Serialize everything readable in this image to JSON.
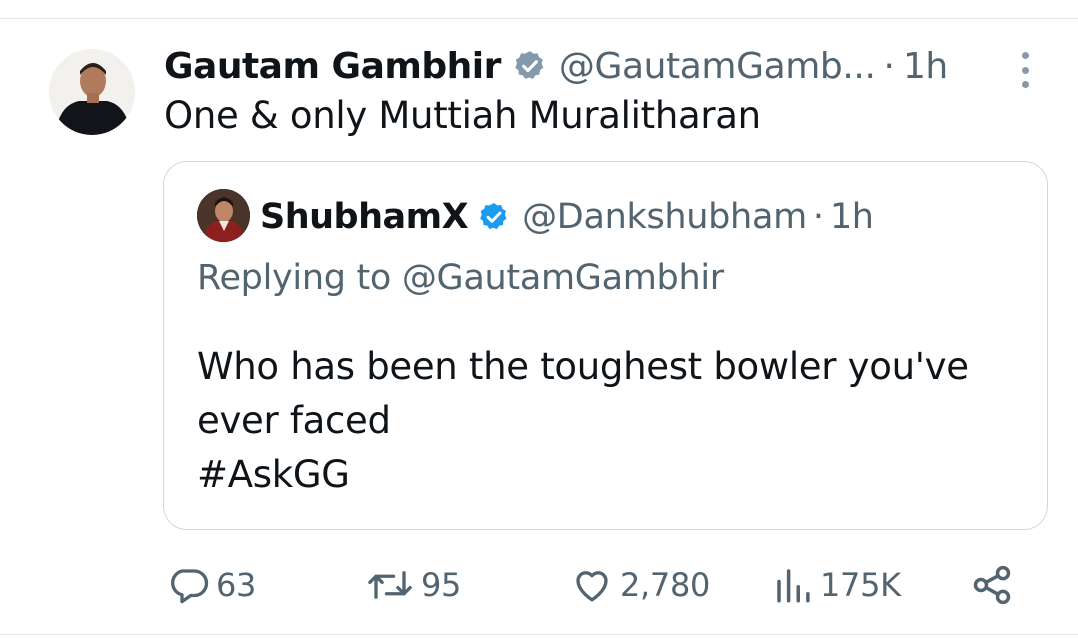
{
  "tweet": {
    "author_name": "Gautam Gambhir",
    "handle": "@GautamGamb...",
    "separator": "·",
    "time": "1h",
    "text": "One & only Muttiah Muralitharan",
    "verified_badge_color": "#829aab"
  },
  "quote": {
    "author_name": "ShubhamX",
    "handle": "@Dankshubham",
    "separator": "·",
    "time": "1h",
    "replying_to": "Replying to @GautamGambhir",
    "body_lines": [
      "Who has been the toughest bowler you've",
      "ever faced",
      "#AskGG"
    ],
    "verified_badge_color": "#1d9bf0"
  },
  "actions": {
    "replies": "63",
    "reposts": "95",
    "likes": "2,780",
    "views": "175K"
  },
  "icons": {
    "reply": "reply-icon",
    "repost": "repost-icon",
    "like": "heart-icon",
    "views": "views-bar-chart-icon",
    "share": "share-icon",
    "more": "more-options-icon"
  },
  "colors": {
    "text_primary": "#0f1419",
    "text_secondary": "#536471",
    "border": "#cfd9de"
  }
}
